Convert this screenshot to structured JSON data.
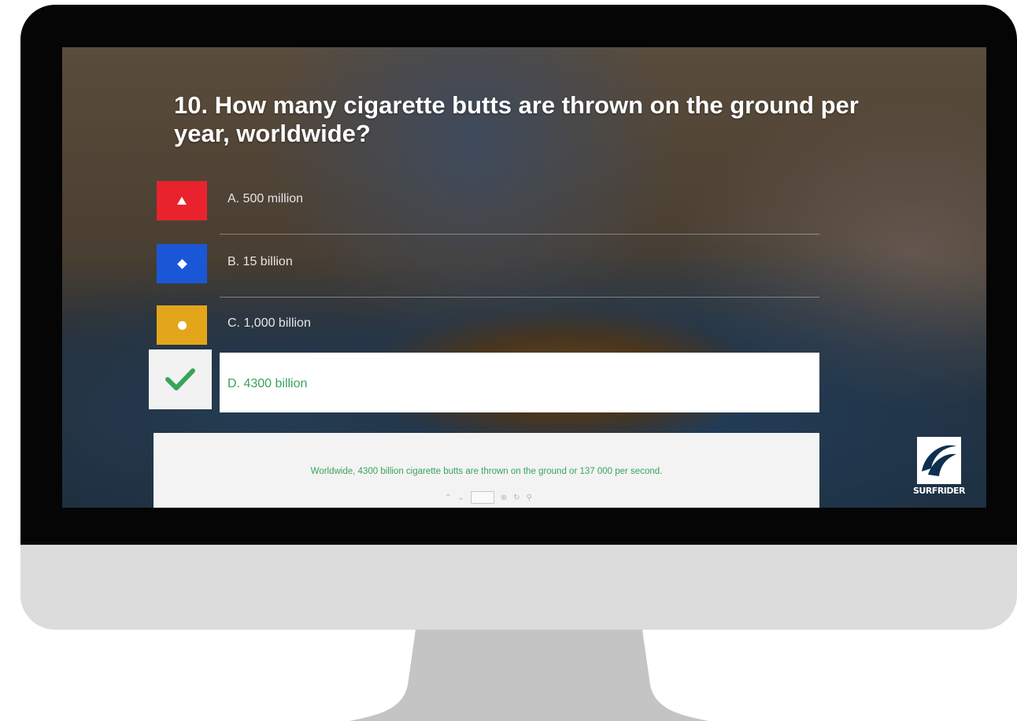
{
  "quiz": {
    "question": "10. How many cigarette butts are thrown on the ground per year, worldwide?",
    "answers": [
      {
        "label": "A. 500 million",
        "color": "#e8232e",
        "shape": "triangle-icon"
      },
      {
        "label": "B. 15 billion",
        "color": "#1a57d6",
        "shape": "diamond-icon"
      },
      {
        "label": "C. 1,000 billion",
        "color": "#e3a51a",
        "shape": "circle-icon"
      }
    ],
    "correct_answer": {
      "label": "D. 4300 billion",
      "color": "#3aa35c",
      "icon": "checkmark-icon"
    },
    "explanation": "Worldwide, 4300 billion cigarette butts are thrown on the ground or 137 000 per second."
  },
  "logo": {
    "text": "SURFRIDER"
  },
  "colors": {
    "monitor_bezel": "#050505",
    "monitor_chin": "#dcdcdc",
    "monitor_stand": "#c4c4c4",
    "correct_green": "#3aa35c"
  }
}
